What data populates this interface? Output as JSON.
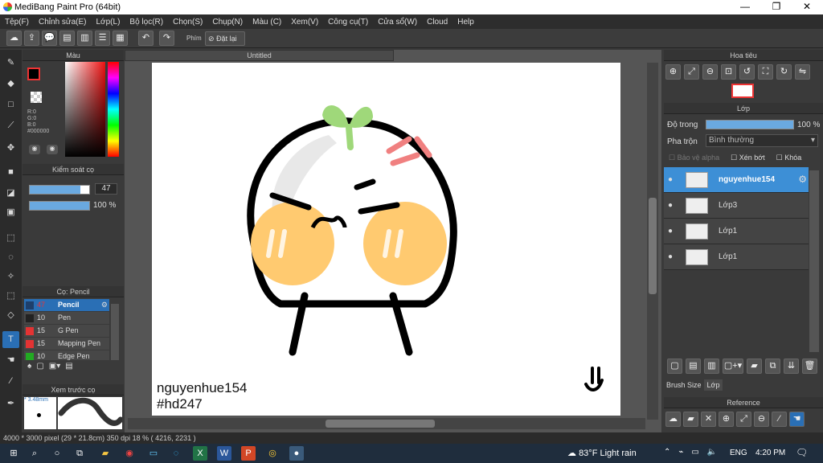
{
  "titlebar": {
    "title": "MediBang Paint Pro (64bit)",
    "minimize": "—",
    "maximize": "❐",
    "close": "✕"
  },
  "menu": [
    "Tệp(F)",
    "Chỉnh sửa(E)",
    "Lớp(L)",
    "Bộ lọc(R)",
    "Chọn(S)",
    "Chụp(N)",
    "Màu (C)",
    "Xem(V)",
    "Công cụ(T)",
    "Cửa sổ(W)",
    "Cloud",
    "Help"
  ],
  "toolbar": {
    "key_label": "Phím",
    "reset_label": "Đặt lại"
  },
  "color_panel": {
    "title": "Màu",
    "r": "R:0",
    "g": "G:0",
    "b": "B:0",
    "hex": "#000000"
  },
  "brush_control": {
    "title": "Kiểm soát cọ",
    "size": "47",
    "opacity": "100 %",
    "size_fill": 0.85,
    "opacity_fill": 1.0
  },
  "brush_panel": {
    "title": "Cọ: Pencil",
    "items": [
      {
        "size": "47",
        "name": "Pencil",
        "color": "#1e3f6b",
        "size_color": "#e33",
        "selected": true
      },
      {
        "size": "10",
        "name": "Pen",
        "color": "#222222",
        "size_color": "#ddd",
        "selected": false
      },
      {
        "size": "15",
        "name": "G Pen",
        "color": "#e33333",
        "size_color": "#ddd",
        "selected": false
      },
      {
        "size": "15",
        "name": "Mapping Pen",
        "color": "#e33333",
        "size_color": "#ddd",
        "selected": false
      },
      {
        "size": "10",
        "name": "Edge Pen",
        "color": "#22aa22",
        "size_color": "#ddd",
        "selected": false
      }
    ]
  },
  "preview_panel": {
    "title": "Xem trước cọ",
    "size": "* 3.48mm"
  },
  "document": {
    "tab": "Untitled",
    "text_line1": "nguyenhue154",
    "text_line2": "#hd247"
  },
  "navigator": {
    "title": "Hoa tiêu"
  },
  "layer_panel": {
    "title": "Lớp",
    "opacity_label": "Độ trong",
    "opacity_value": "100 %",
    "blend_label": "Pha trộn",
    "blend_value": "Bình thường",
    "protect_alpha": "Bảo vệ alpha",
    "clip": "Xén bớt",
    "lock": "Khóa",
    "layers": [
      {
        "name": "nguyenhue154",
        "selected": true
      },
      {
        "name": "Lớp3",
        "selected": false
      },
      {
        "name": "Lớp1",
        "selected": false
      },
      {
        "name": "Lớp1",
        "selected": false
      }
    ],
    "tab_brush_size": "Brush Size",
    "tab_layer": "Lớp"
  },
  "reference": {
    "title": "Reference"
  },
  "status": {
    "text": "4000 * 3000 pixel   (29 * 21.8cm)   350 dpi   18 %   ( 4216, 2231 )"
  },
  "taskbar": {
    "weather": "83°F  Light rain",
    "lang": "ENG",
    "time": "4:20 PM"
  }
}
